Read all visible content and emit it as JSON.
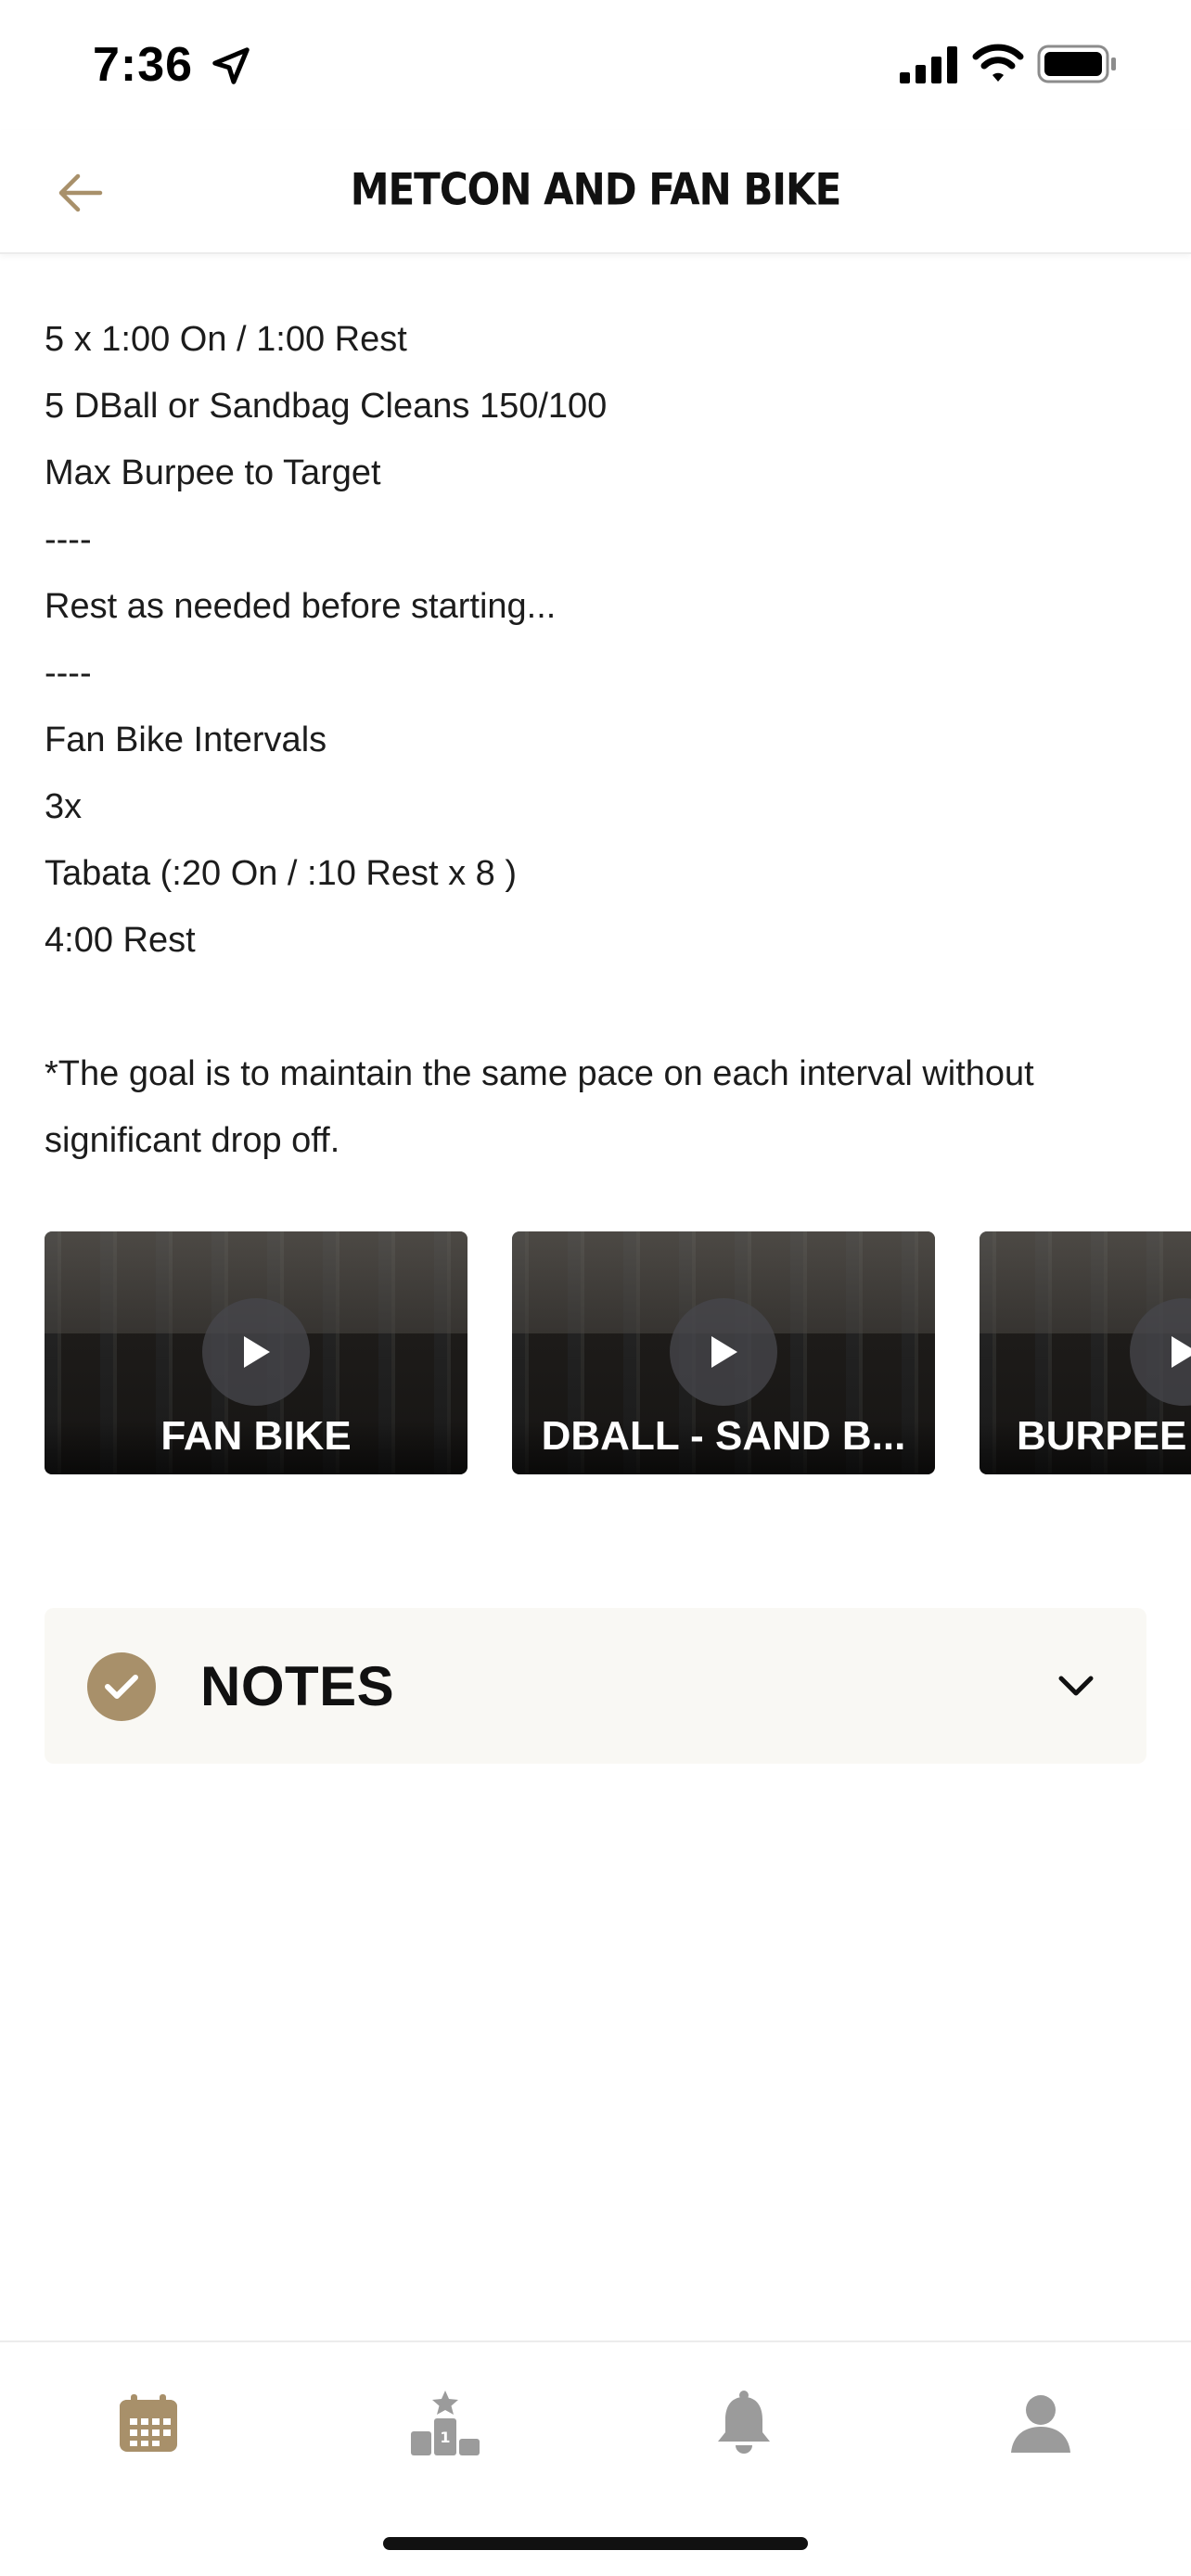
{
  "status_bar": {
    "time": "7:36"
  },
  "header": {
    "title": "METCON AND FAN BIKE"
  },
  "description": {
    "lines": [
      "5 x 1:00 On / 1:00 Rest",
      "5 DBall or Sandbag Cleans 150/100",
      "Max Burpee to Target",
      "----",
      "Rest as needed before starting...",
      "----",
      "Fan Bike Intervals",
      "3x",
      "Tabata (:20 On / :10 Rest x 8 )",
      "4:00 Rest",
      "",
      "*The goal is to maintain the same pace on each interval without",
      "significant drop off."
    ]
  },
  "videos": [
    {
      "label": "FAN BIKE"
    },
    {
      "label": "DBALL - SAND B..."
    },
    {
      "label": "BURPEE"
    }
  ],
  "notes": {
    "label": "NOTES"
  },
  "colors": {
    "accent": "#a8906a",
    "tab_inactive": "#9b9b9b",
    "notes_bg": "#f9f8f4"
  },
  "tab_bar": {
    "tabs": [
      {
        "icon": "calendar-icon",
        "active": true
      },
      {
        "icon": "leaderboard-icon",
        "active": false
      },
      {
        "icon": "bell-icon",
        "active": false
      },
      {
        "icon": "profile-icon",
        "active": false
      }
    ]
  }
}
